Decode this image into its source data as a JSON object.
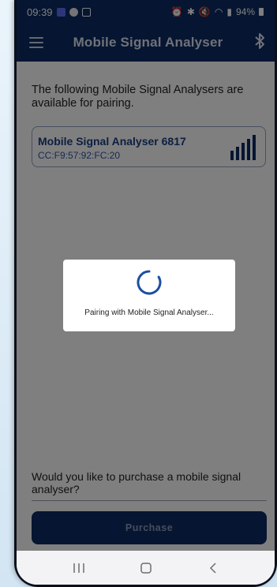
{
  "status_bar": {
    "time": "09:39",
    "battery": "94%"
  },
  "app_bar": {
    "title": "Mobile Signal Analyser",
    "menu_icon": "hamburger-menu-icon",
    "bluetooth_icon": "bluetooth-icon"
  },
  "main": {
    "intro_text": "The following Mobile Signal Analysers are available for pairing.",
    "devices": [
      {
        "name": "Mobile Signal Analyser 6817",
        "mac": "CC:F9:57:92:FC:20",
        "signal_icon": "signal-strength-icon"
      }
    ],
    "purchase_question": "Would you like to purchase a mobile signal analyser?",
    "purchase_label": "Purchase"
  },
  "dialog": {
    "message": "Pairing with Mobile Signal Analyser..."
  },
  "nav_bar": {
    "items": [
      "recent-apps-icon",
      "home-icon",
      "back-icon"
    ]
  },
  "colors": {
    "primary": "#0c2a63",
    "card_border": "#8fa3c4",
    "device_name": "#1b3e82",
    "spinner": "#1b4fa0"
  }
}
